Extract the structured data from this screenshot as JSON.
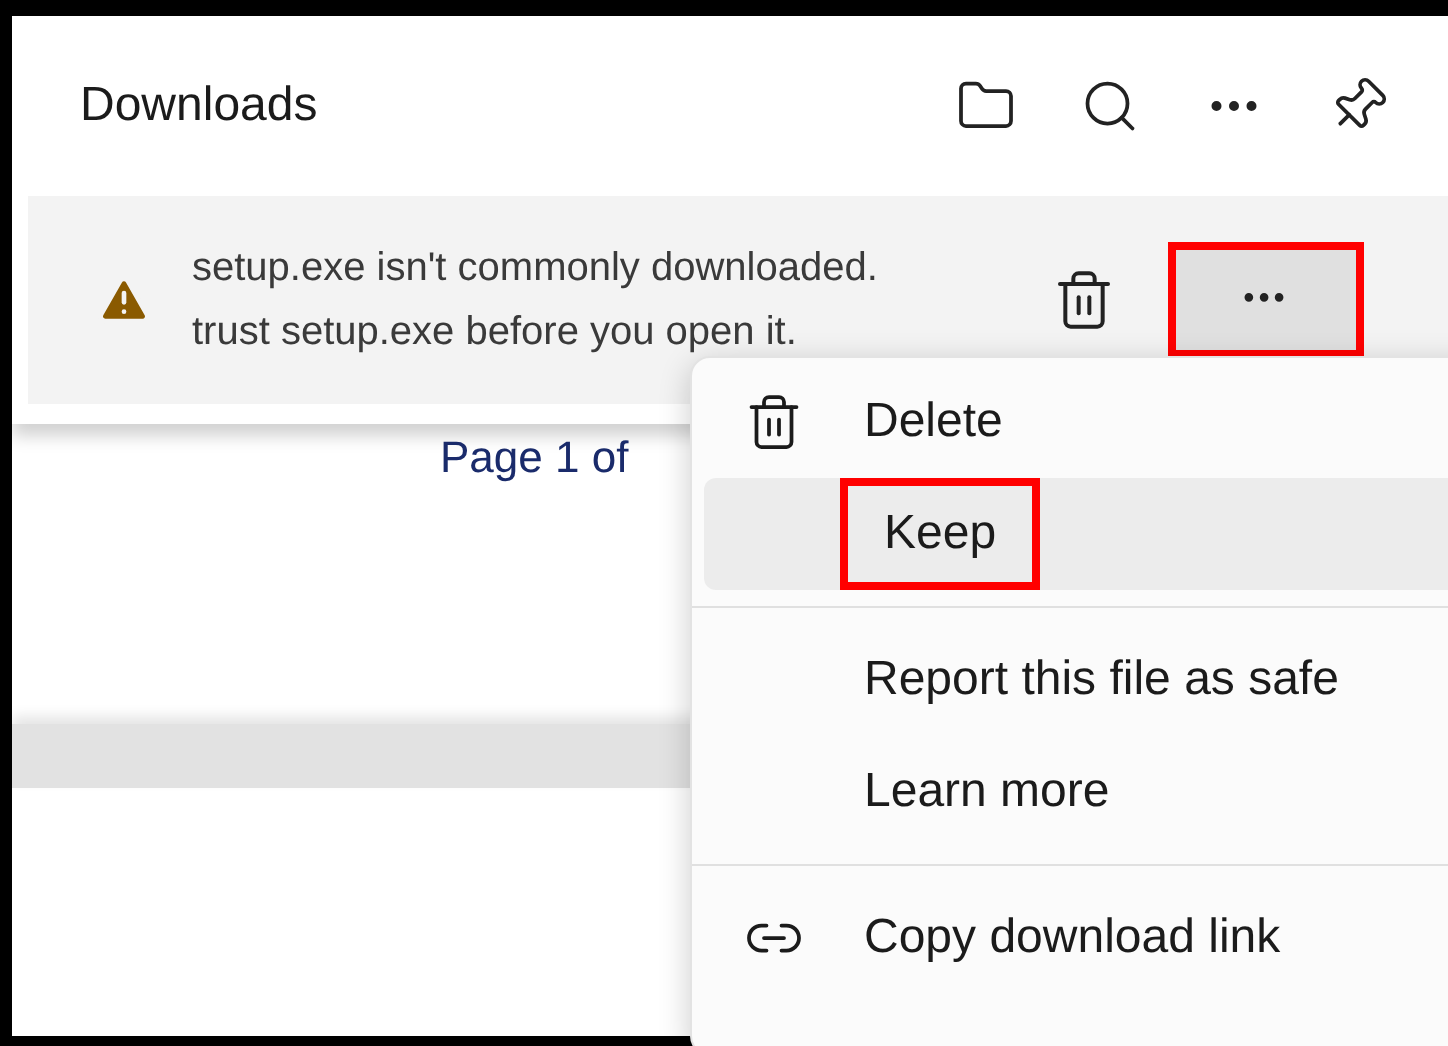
{
  "panel": {
    "title": "Downloads"
  },
  "download": {
    "message_lines": [
      "setup.exe isn't commonly downloaded.",
      "trust setup.exe before you open it."
    ],
    "more_button": {
      "label": "•••",
      "annotated": true
    }
  },
  "page": {
    "text": "Page 1 of"
  },
  "menu": {
    "items": [
      {
        "kind": "delete",
        "label": "Delete",
        "selected": false,
        "annotated": false
      },
      {
        "kind": "plain",
        "label": "Keep",
        "selected": true,
        "annotated": true
      },
      {
        "kind": "separator"
      },
      {
        "kind": "plain",
        "label": "Report this file as safe",
        "selected": false,
        "annotated": false
      },
      {
        "kind": "plain",
        "label": "Learn more",
        "selected": false,
        "annotated": false
      },
      {
        "kind": "separator"
      },
      {
        "kind": "link",
        "label": "Copy download link",
        "selected": false,
        "annotated": false
      }
    ]
  }
}
